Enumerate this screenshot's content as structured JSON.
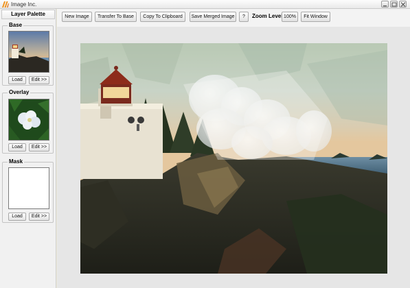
{
  "window": {
    "title": "Image Inc."
  },
  "palette": {
    "header": "Layer Palette",
    "groups": [
      {
        "title": "Base",
        "load": "Load",
        "edit": "Edit >>"
      },
      {
        "title": "Overlay",
        "load": "Load",
        "edit": "Edit >>"
      },
      {
        "title": "Mask",
        "load": "Load",
        "edit": "Edit >>"
      }
    ]
  },
  "toolbar": {
    "new_image": "New Image",
    "transfer_to_base": "Transfer To Base",
    "copy_to_clipboard": "Copy To Clipboard",
    "save_merged": "Save Merged Image",
    "help": "?",
    "zoom_label": "Zoom Level",
    "zoom_value": "100%",
    "fit_window": "Fit Window"
  },
  "icons": {
    "app": "app-logo-icon",
    "minimize": "minimize-icon",
    "maximize": "maximize-icon",
    "close": "close-icon"
  },
  "colors": {
    "logo": "#f0921a",
    "sky_top": "#c9d8c7",
    "sea": "#4a6f86",
    "rocks": "#2a2a22",
    "lighthouse_cap": "#8a2a1c"
  }
}
